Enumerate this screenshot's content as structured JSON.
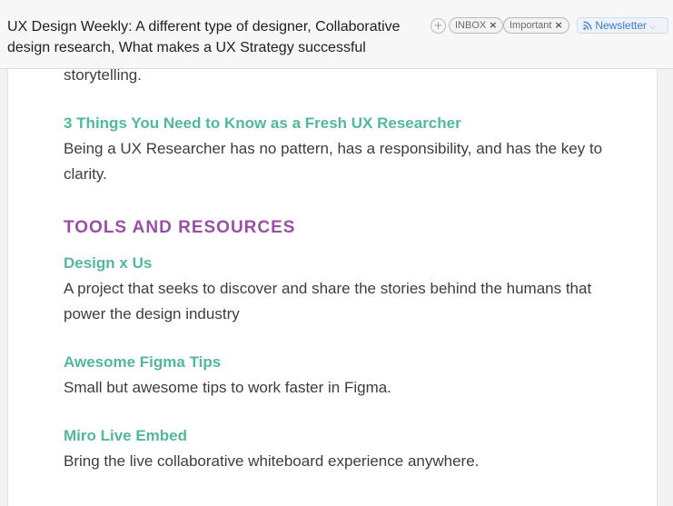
{
  "header": {
    "subject": "UX Design Weekly: A different type of designer, Collaborative design research,  What makes a UX Strategy successful",
    "tags": [
      {
        "label": "INBOX",
        "remove": "×"
      },
      {
        "label": "Important",
        "remove": "×"
      }
    ],
    "add_tag_symbol": "+",
    "category": {
      "label": "Newsletter",
      "icon": "rss-icon",
      "color": "#3b7ad6"
    }
  },
  "email": {
    "top_fragment": "storytelling.",
    "article": {
      "title": "3 Things You Need to Know as a Fresh UX Researcher",
      "desc_line1": "Being a UX Researcher has no pattern, has a responsibility, and has the key to",
      "desc_line2": "clarity."
    },
    "section_title": "TOOLS AND RESOURCES",
    "resources": [
      {
        "title": "Design x Us",
        "desc_line1": "A project that seeks to discover and share the stories behind the humans that",
        "desc_line2": "power the design industry"
      },
      {
        "title": "Awesome Figma Tips",
        "desc_line1": "Small but awesome tips to work faster in Figma."
      },
      {
        "title": "Miro Live Embed",
        "desc_line1": "Bring the live collaborative whiteboard experience anywhere."
      }
    ]
  },
  "colors": {
    "link": "#52b89b",
    "section": "#9a4fa6",
    "body_text": "#3d3d3d",
    "newsletter": "#3b7ad6"
  }
}
